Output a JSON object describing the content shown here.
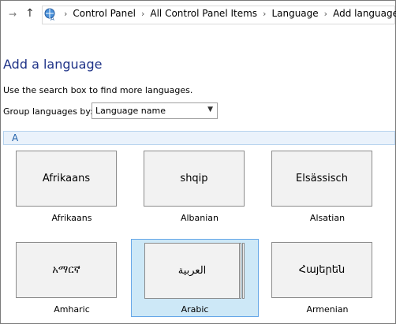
{
  "address_bar": {
    "breadcrumbs": [
      "Control Panel",
      "All Control Panel Items",
      "Language",
      "Add languages"
    ]
  },
  "page": {
    "title": "Add a language",
    "hint": "Use the search box to find more languages.",
    "group_by_label": "Group languages by:",
    "group_by_value": "Language name"
  },
  "group_header": "A",
  "languages": [
    {
      "native": "Afrikaans",
      "name": "Afrikaans"
    },
    {
      "native": "shqip",
      "name": "Albanian"
    },
    {
      "native": "Elsässisch",
      "name": "Alsatian"
    },
    {
      "native": "አማርኛ",
      "name": "Amharic"
    },
    {
      "native": "العربية",
      "name": "Arabic",
      "selected": true
    },
    {
      "native": "Հայերեն",
      "name": "Armenian"
    }
  ],
  "colors": {
    "title": "#1e3287",
    "group_header_bg": "#eaf2fb",
    "selection_bg": "#cde8f7",
    "selection_border": "#66a7e8"
  }
}
